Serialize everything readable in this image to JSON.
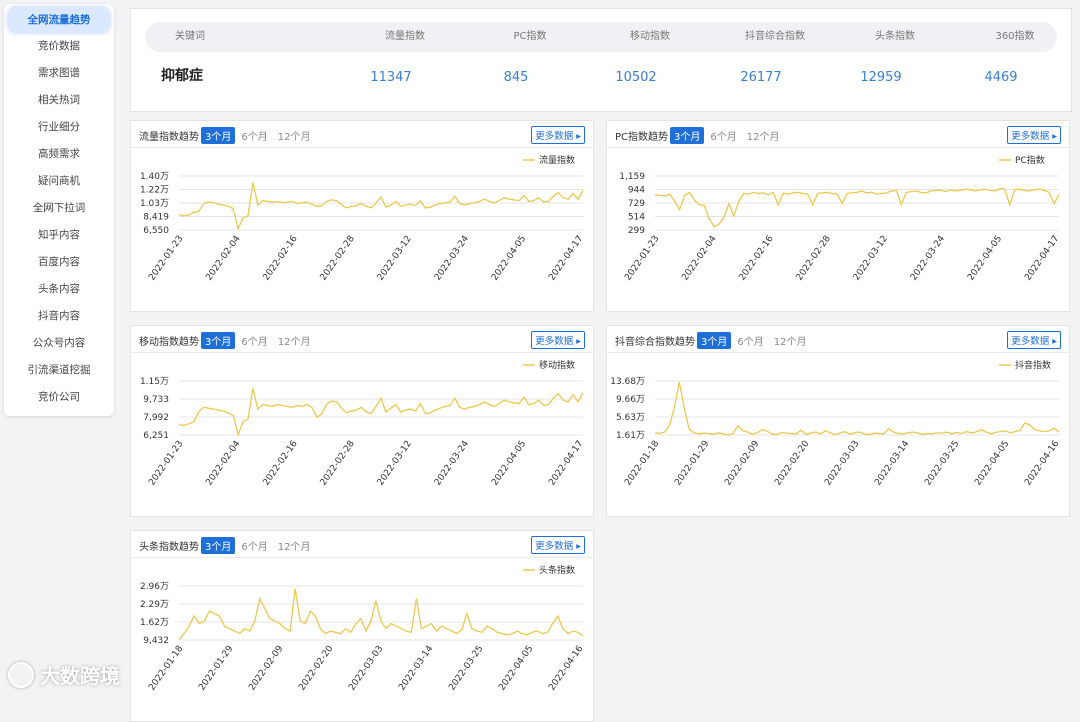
{
  "sidebar": {
    "items": [
      {
        "label": "全网流量趋势",
        "active": true
      },
      {
        "label": "竞价数据"
      },
      {
        "label": "需求图谱"
      },
      {
        "label": "相关热词"
      },
      {
        "label": "行业细分"
      },
      {
        "label": "高频需求"
      },
      {
        "label": "疑问商机"
      },
      {
        "label": "全网下拉词"
      },
      {
        "label": "知乎内容"
      },
      {
        "label": "百度内容"
      },
      {
        "label": "头条内容"
      },
      {
        "label": "抖音内容"
      },
      {
        "label": "公众号内容"
      },
      {
        "label": "引流渠道挖掘"
      },
      {
        "label": "竞价公司"
      }
    ]
  },
  "keyword_table": {
    "headers": [
      "关键词",
      "流量指数",
      "PC指数",
      "移动指数",
      "抖音综合指数",
      "头条指数",
      "360指数"
    ],
    "keyword": "抑郁症",
    "values": [
      "11347",
      "845",
      "10502",
      "26177",
      "12959",
      "4469"
    ]
  },
  "range_labels": [
    "3个月",
    "6个月",
    "12个月"
  ],
  "more_label": "更多数据",
  "watermark": "大数跨境",
  "colors": {
    "line": "#ecc84f",
    "accent": "#1f6fd8",
    "grid": "#e4e4e4"
  },
  "charts": [
    {
      "title": "流量指数趋势",
      "legend": "流量指数",
      "chart_data": {
        "type": "line",
        "series": [
          {
            "name": "流量指数",
            "values": [
              8700,
              8500,
              8600,
              9000,
              9100,
              10200,
              10400,
              10300,
              10100,
              10000,
              9800,
              9500,
              6700,
              8200,
              8500,
              13100,
              10000,
              10600,
              10500,
              10400,
              10500,
              10300,
              10400,
              10500,
              10200,
              10300,
              10400,
              10100,
              9800,
              9900,
              10500,
              10700,
              10600,
              10000,
              9600,
              9800,
              9900,
              10200,
              9800,
              9600,
              10300,
              11100,
              9700,
              10000,
              10500,
              9800,
              10000,
              10100,
              9900,
              10600,
              9600,
              9700,
              10000,
              10200,
              10300,
              10400,
              11200,
              10200,
              10000,
              10200,
              10300,
              10500,
              10800,
              10500,
              10300,
              10600,
              11000,
              10800,
              10700,
              10600,
              11300,
              10500,
              10600,
              11000,
              10400,
              10500,
              11200,
              11700,
              11000,
              10800,
              11600,
              10800,
              12000
            ]
          }
        ],
        "y_ticks": [
          "6,550",
          "8,419",
          "1.03万",
          "1.22万",
          "1.40万"
        ],
        "ylim": [
          6550,
          14000
        ],
        "x_ticks": [
          "2022-01-23",
          "2022-02-04",
          "2022-02-16",
          "2022-02-28",
          "2022-03-12",
          "2022-03-24",
          "2022-04-05",
          "2022-04-17"
        ]
      }
    },
    {
      "title": "PC指数趋势",
      "legend": "PC指数",
      "chart_data": {
        "type": "line",
        "series": [
          {
            "name": "PC指数",
            "values": [
              860,
              850,
              840,
              870,
              760,
              620,
              850,
              900,
              780,
              700,
              690,
              480,
              350,
              390,
              500,
              720,
              520,
              760,
              880,
              870,
              900,
              880,
              890,
              860,
              900,
              700,
              880,
              870,
              890,
              900,
              880,
              870,
              700,
              880,
              890,
              900,
              880,
              870,
              720,
              880,
              890,
              900,
              920,
              890,
              900,
              870,
              880,
              890,
              920,
              930,
              700,
              900,
              910,
              920,
              900,
              890,
              920,
              930,
              930,
              910,
              940,
              920,
              930,
              950,
              940,
              920,
              940,
              950,
              930,
              920,
              960,
              950,
              700,
              940,
              950,
              930,
              920,
              940,
              950,
              930,
              900,
              720,
              860
            ]
          }
        ],
        "y_ticks": [
          "299",
          "514",
          "729",
          "944",
          "1,159"
        ],
        "ylim": [
          299,
          1159
        ],
        "x_ticks": [
          "2022-01-23",
          "2022-02-04",
          "2022-02-16",
          "2022-02-28",
          "2022-03-12",
          "2022-03-24",
          "2022-04-05",
          "2022-04-17"
        ]
      }
    },
    {
      "title": "移动指数趋势",
      "legend": "移动指数",
      "chart_data": {
        "type": "line",
        "series": [
          {
            "name": "移动指数",
            "values": [
              7400,
              7300,
              7500,
              7700,
              8800,
              9300,
              9200,
              9100,
              9000,
              8900,
              8700,
              8400,
              6300,
              7700,
              8000,
              11400,
              9100,
              9600,
              9500,
              9400,
              9600,
              9500,
              9400,
              9300,
              9500,
              9400,
              9600,
              9300,
              8200,
              8600,
              9700,
              10000,
              9900,
              9200,
              8700,
              8900,
              9000,
              9300,
              8800,
              8600,
              9400,
              10300,
              8800,
              9200,
              9600,
              8800,
              9000,
              9100,
              8900,
              9700,
              8600,
              8700,
              9000,
              9200,
              9400,
              9500,
              10300,
              9300,
              9100,
              9300,
              9400,
              9600,
              9900,
              9600,
              9400,
              9700,
              10100,
              9900,
              9800,
              9700,
              10400,
              9600,
              9700,
              10100,
              9500,
              9600,
              10300,
              10800,
              10100,
              9900,
              10700,
              9900,
              10900
            ]
          }
        ],
        "y_ticks": [
          "6,251",
          "7,992",
          "9,733",
          "1.15万"
        ],
        "ylim": [
          6251,
          12200
        ],
        "x_ticks": [
          "2022-01-23",
          "2022-02-04",
          "2022-02-16",
          "2022-02-28",
          "2022-03-12",
          "2022-03-24",
          "2022-04-05",
          "2022-04-17"
        ]
      }
    },
    {
      "title": "抖音综合指数趋势",
      "legend": "抖音指数",
      "chart_data": {
        "type": "line",
        "series": [
          {
            "name": "抖音指数",
            "values": [
              22000,
              20000,
              24000,
              42000,
              90000,
              155000,
              88000,
              32000,
              22000,
              19000,
              21000,
              20000,
              18000,
              22000,
              19000,
              16000,
              19000,
              40000,
              28000,
              24000,
              18000,
              22000,
              30000,
              26000,
              19000,
              17000,
              23000,
              21000,
              20000,
              19000,
              29000,
              18000,
              21000,
              24000,
              19000,
              27000,
              22000,
              17000,
              21000,
              25000,
              18000,
              22000,
              24000,
              19000,
              17000,
              21000,
              20000,
              19000,
              33000,
              24000,
              20000,
              19000,
              22000,
              24000,
              21000,
              18000,
              20000,
              19000,
              22000,
              21000,
              24000,
              19000,
              23000,
              20000,
              25000,
              22000,
              24000,
              30000,
              24000,
              19000,
              23000,
              25000,
              27000,
              22000,
              25000,
              29000,
              48000,
              42000,
              30000,
              27000,
              25000,
              27000,
              34000,
              24000
            ]
          }
        ],
        "y_ticks": [
          "1.61万",
          "5.63万",
          "9.66万",
          "13.68万"
        ],
        "ylim": [
          16100,
          158000
        ],
        "x_ticks": [
          "2022-01-18",
          "2022-01-29",
          "2022-02-09",
          "2022-02-20",
          "2022-03-03",
          "2022-03-14",
          "2022-03-25",
          "2022-04-05",
          "2022-04-16"
        ]
      }
    },
    {
      "title": "头条指数趋势",
      "legend": "头条指数",
      "chart_data": {
        "type": "line",
        "series": [
          {
            "name": "头条指数",
            "values": [
              9600,
              12000,
              15000,
              19000,
              16000,
              17000,
              21000,
              20000,
              19000,
              15000,
              14000,
              13000,
              12000,
              14000,
              13000,
              17000,
              26000,
              22000,
              18000,
              17000,
              16000,
              14000,
              13000,
              30000,
              17000,
              16000,
              21000,
              19000,
              14000,
              12000,
              13000,
              12500,
              12000,
              14000,
              12500,
              16000,
              18000,
              13000,
              17000,
              25000,
              17000,
              14000,
              16000,
              15000,
              14000,
              13000,
              12500,
              26000,
              14000,
              15000,
              16000,
              13000,
              15000,
              14000,
              13000,
              12000,
              13500,
              20000,
              14000,
              13000,
              12500,
              15000,
              14000,
              12500,
              12000,
              11500,
              12000,
              13000,
              12000,
              11500,
              12500,
              13000,
              12000,
              12500,
              16000,
              19000,
              14000,
              12000,
              13000,
              12500,
              11000
            ]
          }
        ],
        "y_ticks": [
          "9,432",
          "1.62万",
          "2.29万",
          "2.96万"
        ],
        "ylim": [
          9432,
          31000
        ],
        "x_ticks": [
          "2022-01-18",
          "2022-01-29",
          "2022-02-09",
          "2022-02-20",
          "2022-03-03",
          "2022-03-14",
          "2022-03-25",
          "2022-04-05",
          "2022-04-16"
        ]
      }
    }
  ]
}
